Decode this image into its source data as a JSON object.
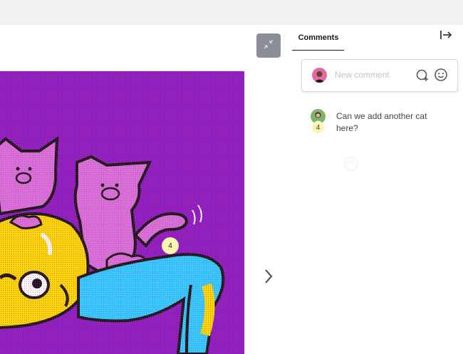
{
  "viewer": {
    "collapse_icon": "collapse-arrows-icon",
    "next_icon": "chevron-right-icon",
    "annotation_pin": {
      "number": "4"
    }
  },
  "comments_panel": {
    "tab_label": "Comments",
    "close_icon": "panel-collapse-icon",
    "composer": {
      "placeholder": "New comment",
      "add_annotation_icon": "add-annotation-icon",
      "emoji_icon": "emoji-icon"
    },
    "threads": [
      {
        "number": "4",
        "text": "Can we add another cat here?"
      }
    ]
  },
  "colors": {
    "artwork_bg": "#8e1fbf",
    "cat_pink": "#d872d8",
    "yellow_face": "#ffd700",
    "blue_shirt": "#33ccff",
    "badge_yellow": "#fbf6b3"
  }
}
